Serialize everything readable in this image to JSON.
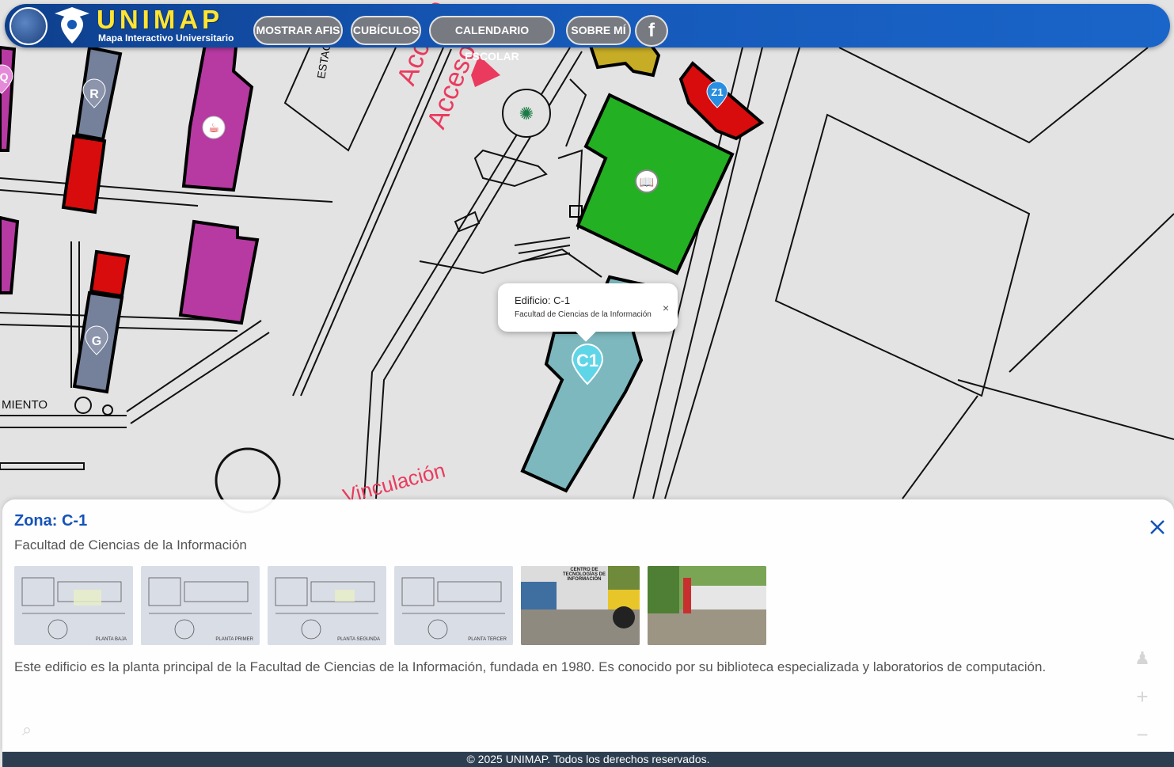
{
  "header": {
    "brand": "UNIMAP",
    "tagline": "Mapa Interactivo Universitario",
    "nav": [
      "MOSTRAR AFIS",
      "CUBÍCULOS",
      "CALENDARIO ESCOLAR",
      "SOBRE MÍ"
    ],
    "facebook_glyph": "f"
  },
  "map": {
    "labels": {
      "acceso_1": "Acceso",
      "acceso_2": "Acceso",
      "estac": "ESTAC",
      "miento": "MIENTO",
      "vinculacion": "Vinculación",
      "acceso_vinc": "Acceso Vinculación"
    },
    "markers": {
      "r": "R",
      "g": "G",
      "q": "Q",
      "z1": "Z1",
      "c1": "C1"
    },
    "icons": [
      "coffee-icon",
      "book-icon",
      "fountain-icon"
    ],
    "colors": {
      "purple": "#b63aa2",
      "red": "#d80c0c",
      "slate": "#75809b",
      "green": "#23b023",
      "teal": "#7db8be",
      "yellow": "#c7ad26",
      "access": "#ea3b5e"
    }
  },
  "popup": {
    "title": "Edificio: C-1",
    "subtitle": "Facultad de Ciencias de la Información",
    "close": "×"
  },
  "panel": {
    "title": "Zona: C-1",
    "subtitle": "Facultad de Ciencias de la Información",
    "photos": [
      {
        "caption": "PLANTA BAJA"
      },
      {
        "caption": "PLANTA PRIMER"
      },
      {
        "caption": "PLANTA SEGUNDA"
      },
      {
        "caption": "PLANTA TERCER"
      },
      {
        "caption": "CENTRO DE TECNOLOGÍAS DE INFORMACIÓN"
      },
      {
        "caption": ""
      }
    ],
    "description": "Este edificio es la planta principal de la Facultad de Ciencias de la Información, fundada en 1980. Es conocido por su biblioteca especializada y laboratorios de computación.",
    "controls": {
      "zoom_in": "+",
      "zoom_out": "−"
    }
  },
  "footer": {
    "text": "© 2025 UNIMAP. Todos los derechos reservados."
  }
}
